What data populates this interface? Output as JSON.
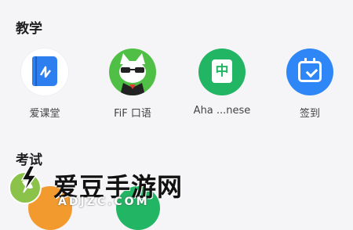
{
  "sections": {
    "teaching_title": "教学",
    "exam_title": "考试"
  },
  "apps": [
    {
      "label": "爱课堂",
      "icon": "book-icon",
      "color": "#2d7ff0"
    },
    {
      "label": "FiF 口语",
      "icon": "cat-mascot-icon",
      "color": "#4fbf45"
    },
    {
      "label": "Aha ...nese",
      "icon": "zhong-character-icon",
      "glyph": "中",
      "color": "#22b564"
    },
    {
      "label": "签到",
      "icon": "calendar-check-icon",
      "color": "#2f86f6"
    }
  ],
  "watermark": {
    "text": "爱豆手游网",
    "url": "ADJZC.COM"
  }
}
